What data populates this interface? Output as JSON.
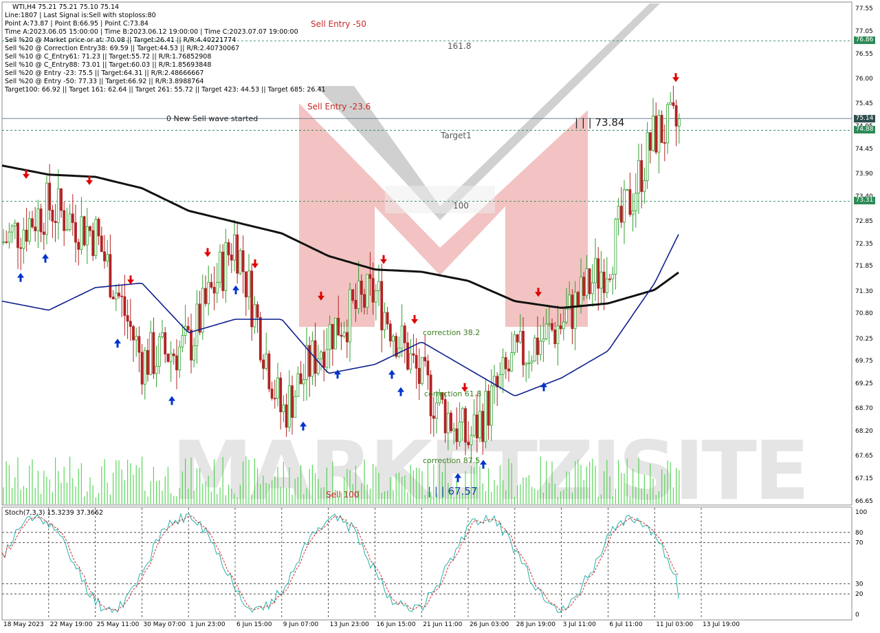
{
  "header": {
    "symbol_line": "WTI,H4  75.21 75.21 75.10 75.14",
    "info_lines": [
      "Line:1807 | Last Signal is:Sell with stoploss:80",
      "Point A:73.87 | Point B:66.95 | Point C:73.84",
      "Time A:2023.06.05 15:00:00 | Time B:2023.06.12 19:00:00 | Time C:2023.07.07 19:00:00",
      "Sell %20 @ Market price or at: 70.08 || Target:26.41 || R/R:4.40221774",
      "Sell %20 @ Correction Entry38: 69.59 || Target:44.53 || R/R:2.40730067",
      "Sell %10 @ C_Entry61: 71.23 || Target:55.72 || R/R:1.76852908",
      "Sell %10 @ C_Entry88: 73.01 || Target:60.03 || R/R:1.85693848",
      "Sell %20 @ Entry -23: 75.5 || Target:64.31 || R/R:2.48666667",
      "Sell %20 @ Entry -50: 77.33 || Target:66.92 || R/R:3.8988764",
      "Target100: 66.92 || Target 161: 62.64 || Target 261: 55.72 || Target 423: 44.53 || Target 685: 26.41"
    ]
  },
  "annotations": {
    "sell_entry_50": "Sell Entry -50",
    "level_161": "161.8",
    "sell_entry_23": "Sell Entry -23.6",
    "new_wave": "0 New Sell wave started",
    "point_c": "| | | 73.84",
    "target1": "Target1",
    "level_100": "100",
    "correction_382": "correction 38.2",
    "correction_618": "correction 61.8",
    "correction_875": "correction 87.5",
    "sell_100": "Sell 100",
    "point_b": "| | | 67.57"
  },
  "price_tags": {
    "current": "75.14",
    "level_161": "76.86",
    "target1": "74.88",
    "level_100": "73.31"
  },
  "colors": {
    "current_tag": "#2f4f4f",
    "level_tag": "#2e8b57",
    "annot_red": "#c62828",
    "annot_green": "#3a7d1e",
    "annot_gray": "#555555",
    "annot_blue": "#1a3fb0",
    "bull": "#2ca02c",
    "bear": "#b22222",
    "ma_slow": "#111111",
    "ma_fast": "#0d1f8c",
    "stoch_main": "#20b2aa",
    "stoch_signal": "#d62728",
    "volume": "#32cd32"
  },
  "watermark": "MARKETZISITE",
  "chart_data": {
    "type": "candlestick",
    "title": "WTI,H4",
    "ylim": [
      66.65,
      77.55
    ],
    "y_ticks": [
      "77.55",
      "77.05",
      "76.55",
      "76.00",
      "75.45",
      "74.95",
      "74.45",
      "73.90",
      "73.40",
      "72.85",
      "72.35",
      "71.85",
      "71.30",
      "70.80",
      "70.25",
      "69.75",
      "69.25",
      "68.70",
      "68.20",
      "67.65",
      "67.15",
      "66.65"
    ],
    "x_ticks": [
      "18 May 2023",
      "22 May 19:00",
      "25 May 11:00",
      "30 May 07:00",
      "1 Jun 23:00",
      "6 Jun 15:00",
      "9 Jun 07:00",
      "13 Jun 23:00",
      "16 Jun 15:00",
      "21 Jun 11:00",
      "26 Jun 03:00",
      "28 Jun 19:00",
      "3 Jul 11:00",
      "6 Jul 11:00",
      "11 Jul 03:00",
      "13 Jul 19:00"
    ],
    "horizontal_levels": [
      {
        "label": "161.8",
        "value": 76.86
      },
      {
        "label": "Target1",
        "value": 74.88
      },
      {
        "label": "100",
        "value": 73.31
      },
      {
        "label": "current",
        "value": 75.14
      }
    ],
    "close_path": [
      {
        "x": "18 May 2023",
        "y": 72.4
      },
      {
        "x": "22 May 19:00",
        "y": 73.2
      },
      {
        "x": "25 May 11:00",
        "y": 72.6
      },
      {
        "x": "30 May 07:00",
        "y": 69.8
      },
      {
        "x": "1 Jun 23:00",
        "y": 70.1
      },
      {
        "x": "6 Jun 15:00",
        "y": 72.5
      },
      {
        "x": "9 Jun 07:00",
        "y": 68.6
      },
      {
        "x": "13 Jun 23:00",
        "y": 70.4
      },
      {
        "x": "16 Jun 15:00",
        "y": 71.3
      },
      {
        "x": "21 Jun 11:00",
        "y": 69.3
      },
      {
        "x": "26 Jun 03:00",
        "y": 68.0
      },
      {
        "x": "28 Jun 19:00",
        "y": 69.8
      },
      {
        "x": "3 Jul 11:00",
        "y": 70.6
      },
      {
        "x": "6 Jul 11:00",
        "y": 72.0
      },
      {
        "x": "11 Jul 03:00",
        "y": 74.8
      },
      {
        "x": "13 Jul 19:00",
        "y": 75.14
      }
    ],
    "ma_slow": [
      74.1,
      73.9,
      73.85,
      73.6,
      73.1,
      72.85,
      72.6,
      72.1,
      71.8,
      71.75,
      71.55,
      71.1,
      70.95,
      71.05,
      71.35,
      72.1
    ],
    "ma_fast": [
      71.1,
      70.9,
      71.4,
      71.5,
      70.4,
      70.7,
      70.7,
      69.5,
      69.7,
      70.2,
      69.6,
      69.0,
      69.4,
      70.0,
      71.5,
      73.6
    ],
    "stochastic": {
      "label": "Stoch(7,3,3) 15.3239 37.3662",
      "main_value": 15.3239,
      "signal_value": 37.3662,
      "levels": [
        80,
        70,
        30,
        20
      ],
      "y_ticks": [
        "100",
        "80",
        "70",
        "30",
        "20",
        "0"
      ]
    }
  }
}
